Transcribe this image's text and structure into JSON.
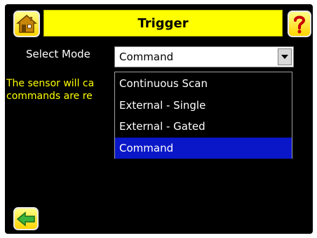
{
  "header": {
    "title": "Trigger"
  },
  "icons": {
    "home": "home-icon",
    "help": "help-icon",
    "back": "back-arrow-icon"
  },
  "colors": {
    "accent": "#ffff00",
    "background": "#000000",
    "selected_option": "#0a17c8"
  },
  "form": {
    "select_mode_label": "Select Mode",
    "select_mode_value": "Command"
  },
  "message": {
    "line1": "The sensor will ca",
    "line2": "commands are re"
  },
  "dropdown": {
    "options": [
      "Continuous Scan",
      "External - Single",
      "External - Gated",
      "Command"
    ],
    "selected_index": 3
  }
}
